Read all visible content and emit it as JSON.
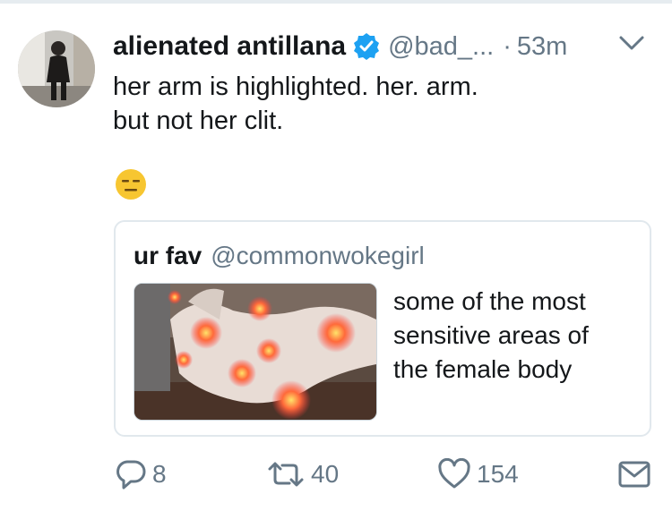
{
  "tweet": {
    "author_name": "alienated antillana",
    "author_handle": "@bad_...",
    "separator": "·",
    "time": "53m",
    "verified": true,
    "text_lines": [
      "her arm is highlighted. her. arm.",
      "but not her clit."
    ],
    "emoji": "expressionless-face-emoji"
  },
  "quoted_tweet": {
    "author_name": "ur fav",
    "author_handle": "@commonwokegirl",
    "text_lines": [
      "some of the most",
      "sensitive areas of",
      "the female body"
    ],
    "image": "photo-with-highlighted-body-areas"
  },
  "actions": {
    "reply_count": "8",
    "retweet_count": "40",
    "like_count": "154"
  },
  "colors": {
    "text": "#14171a",
    "secondary": "#657786",
    "verified": "#1da1f2",
    "border": "#e1e8ed"
  }
}
